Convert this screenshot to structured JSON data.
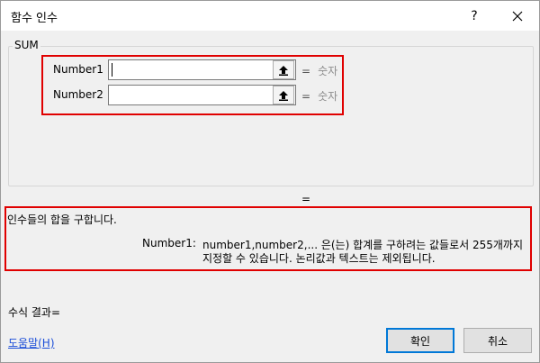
{
  "window": {
    "title": "함수 인수",
    "help_label": "?",
    "close_icon": "close-icon"
  },
  "function_group": {
    "name": "SUM"
  },
  "arguments": [
    {
      "label": "Number1",
      "value": "",
      "result": "숫자"
    },
    {
      "label": "Number2",
      "value": "",
      "result": "숫자"
    }
  ],
  "equals": "=",
  "formula_equals": "=",
  "description": {
    "main": "인수들의 합을 구합니다.",
    "arg_name": "Number1:",
    "arg_text_line1": "number1,number2,... 은(는) 합계를 구하려는 값들로서 255개까지",
    "arg_text_line2": "지정할 수 있습니다. 논리값과 텍스트는 제외됩니다."
  },
  "formula_result_label": "수식 결과=",
  "help_link": "도움말(H)",
  "buttons": {
    "ok": "확인",
    "cancel": "취소"
  },
  "colors": {
    "highlight_border": "#e00000",
    "link": "#1a4dd8",
    "focus": "#0078d7"
  }
}
